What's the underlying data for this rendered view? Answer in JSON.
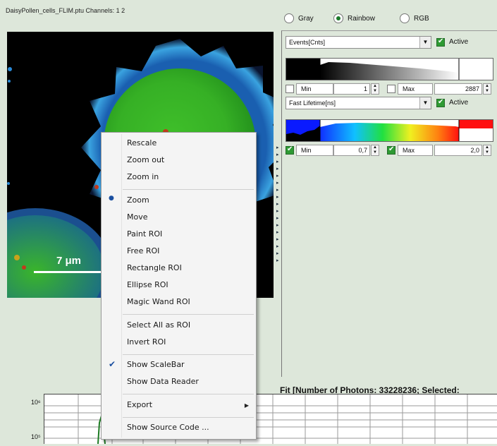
{
  "image_panel": {
    "title": "DaisyPollen_cells_FLIM.ptu Channels: 1 2",
    "scalebar_label": "7 μm"
  },
  "color_mode": {
    "options": [
      "Gray",
      "Rainbow",
      "RGB"
    ],
    "selected": "Rainbow"
  },
  "channel1": {
    "combo": "Events[Cnts]",
    "active_label": "Active",
    "active": true,
    "min_label": "Min",
    "min_checked": false,
    "min_value": "1",
    "max_label": "Max",
    "max_checked": false,
    "max_value": "2887"
  },
  "channel2": {
    "combo": "Fast Lifetime[ns]",
    "active_label": "Active",
    "active": true,
    "min_label": "Min",
    "min_checked": true,
    "min_value": "0,7",
    "max_label": "Max",
    "max_checked": true,
    "max_value": "2,0"
  },
  "fit": {
    "title": "Fit [Number of Photons: 33228236; Selected: "
  },
  "plot": {
    "y_ticks": [
      "10⁶",
      "10⁵"
    ]
  },
  "context_menu": {
    "items": [
      {
        "label": "Rescale"
      },
      {
        "label": "Zoom out"
      },
      {
        "label": "Zoom in"
      },
      {
        "label": "Zoom",
        "mark": "radio"
      },
      {
        "label": "Move"
      },
      {
        "label": "Paint ROI"
      },
      {
        "label": "Free ROI"
      },
      {
        "label": "Rectangle ROI"
      },
      {
        "label": "Ellipse ROI"
      },
      {
        "label": "Magic Wand ROI"
      },
      {
        "label": "Select All as ROI"
      },
      {
        "label": "Invert ROI"
      },
      {
        "label": "Show ScaleBar",
        "mark": "check"
      },
      {
        "label": "Show Data Reader"
      },
      {
        "label": "Export",
        "submenu": true
      },
      {
        "label": "Show Source Code ..."
      }
    ]
  },
  "colors": {
    "panel_bg": "#dde7da",
    "accent_green": "#2e9a33",
    "check_blue": "#1a4fa0"
  }
}
